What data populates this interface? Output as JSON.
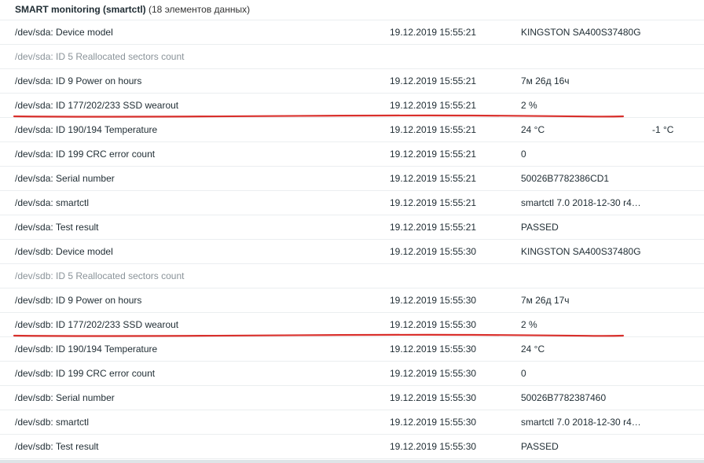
{
  "group": {
    "title": "SMART monitoring (smartctl)",
    "count": "(18 элементов данных)"
  },
  "rows": [
    {
      "name": "/dev/sda: Device model",
      "time": "19.12.2019 15:55:21",
      "value": "KINGSTON SA400S37480G",
      "change": ""
    },
    {
      "name": "/dev/sda: ID 5 Reallocated sectors count",
      "time": "",
      "value": "",
      "change": ""
    },
    {
      "name": "/dev/sda: ID 9 Power on hours",
      "time": "19.12.2019 15:55:21",
      "value": "7м 26д 16ч",
      "change": ""
    },
    {
      "name": "/dev/sda: ID 177/202/233 SSD wearout",
      "time": "19.12.2019 15:55:21",
      "value": "2 %",
      "change": ""
    },
    {
      "name": "/dev/sda: ID 190/194 Temperature",
      "time": "19.12.2019 15:55:21",
      "value": "24 °C",
      "change": "-1 °C"
    },
    {
      "name": "/dev/sda: ID 199 CRC error count",
      "time": "19.12.2019 15:55:21",
      "value": "0",
      "change": ""
    },
    {
      "name": "/dev/sda: Serial number",
      "time": "19.12.2019 15:55:21",
      "value": "50026B7782386CD1",
      "change": ""
    },
    {
      "name": "/dev/sda: smartctl",
      "time": "19.12.2019 15:55:21",
      "value": "smartctl 7.0 2018-12-30 r4…",
      "change": ""
    },
    {
      "name": "/dev/sda: Test result",
      "time": "19.12.2019 15:55:21",
      "value": "PASSED",
      "change": ""
    },
    {
      "name": "/dev/sdb: Device model",
      "time": "19.12.2019 15:55:30",
      "value": "KINGSTON SA400S37480G",
      "change": ""
    },
    {
      "name": "/dev/sdb: ID 5 Reallocated sectors count",
      "time": "",
      "value": "",
      "change": ""
    },
    {
      "name": "/dev/sdb: ID 9 Power on hours",
      "time": "19.12.2019 15:55:30",
      "value": "7м 26д 17ч",
      "change": ""
    },
    {
      "name": "/dev/sdb: ID 177/202/233 SSD wearout",
      "time": "19.12.2019 15:55:30",
      "value": "2 %",
      "change": ""
    },
    {
      "name": "/dev/sdb: ID 190/194 Temperature",
      "time": "19.12.2019 15:55:30",
      "value": "24 °C",
      "change": ""
    },
    {
      "name": "/dev/sdb: ID 199 CRC error count",
      "time": "19.12.2019 15:55:30",
      "value": "0",
      "change": ""
    },
    {
      "name": "/dev/sdb: Serial number",
      "time": "19.12.2019 15:55:30",
      "value": "50026B7782387460",
      "change": ""
    },
    {
      "name": "/dev/sdb: smartctl",
      "time": "19.12.2019 15:55:30",
      "value": "smartctl 7.0 2018-12-30 r4…",
      "change": ""
    },
    {
      "name": "/dev/sdb: Test result",
      "time": "19.12.2019 15:55:30",
      "value": "PASSED",
      "change": ""
    }
  ],
  "disabled_rows": [
    1,
    10
  ],
  "annotation_color": "#d9302c"
}
